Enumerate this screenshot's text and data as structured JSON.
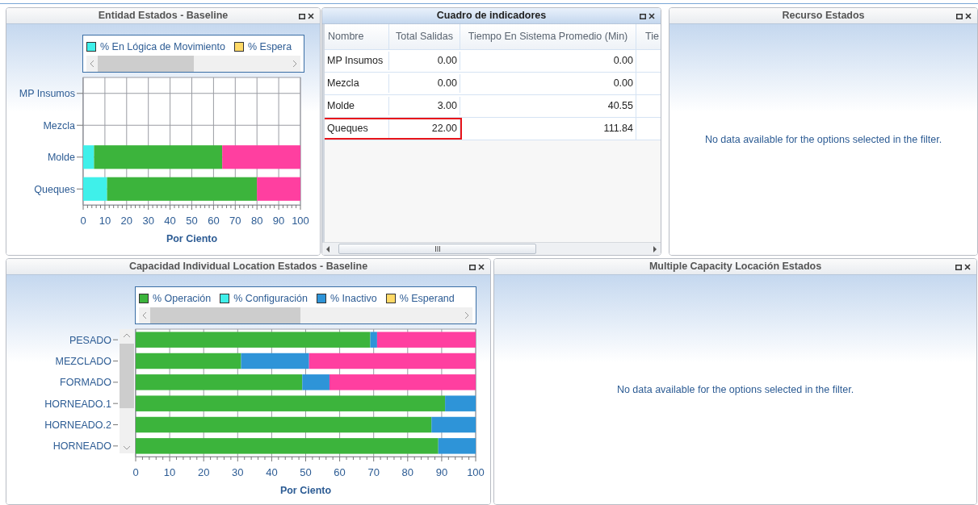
{
  "panels": [
    {
      "kind": "chart",
      "title": "Entidad Estados - Baseline",
      "chart_data": {
        "type": "bar",
        "orientation": "horizontal",
        "stacked": true,
        "grid": true,
        "xlabel": "Por Ciento",
        "xlim": [
          0,
          100
        ],
        "xticks": [
          0,
          10,
          20,
          30,
          40,
          50,
          60,
          70,
          80,
          90,
          100
        ],
        "categories": [
          "MP Insumos",
          "Mezcla",
          "Molde",
          "Queques"
        ],
        "series": [
          {
            "name": "% En Lógica de Movimiento",
            "color": "#3ff0ea",
            "values": [
              0,
              0,
              5,
              11
            ]
          },
          {
            "name": "% Espera",
            "color": "#ffd966",
            "values": [
              0,
              0,
              0,
              0
            ]
          },
          {
            "color": "#3cb43c",
            "values": [
              0,
              0,
              59,
              69
            ]
          },
          {
            "color": "#ff3fa0",
            "values": [
              0,
              0,
              36,
              20
            ]
          }
        ]
      }
    },
    {
      "kind": "table",
      "title": "Cuadro de indicadores",
      "columns": [
        "Nombre",
        "Total Salidas",
        "Tiempo En Sistema Promedio (Min)",
        "Tie"
      ],
      "rows": [
        {
          "cells": [
            "MP Insumos",
            "0.00",
            "0.00"
          ],
          "highlighted": false
        },
        {
          "cells": [
            "Mezcla",
            "0.00",
            "0.00"
          ],
          "highlighted": false
        },
        {
          "cells": [
            "Molde",
            "3.00",
            "40.55"
          ],
          "highlighted": false
        },
        {
          "cells": [
            "Queques",
            "22.00",
            "111.84"
          ],
          "highlighted": true
        }
      ]
    },
    {
      "kind": "empty",
      "title": "Recurso Estados",
      "message": "No data available for the options selected in the filter."
    },
    {
      "kind": "chart",
      "title": "Capacidad Individual Location Estados - Baseline",
      "chart_data": {
        "type": "bar",
        "orientation": "horizontal",
        "stacked": true,
        "grid": true,
        "xlabel": "Por Ciento",
        "xlim": [
          0,
          100
        ],
        "xticks": [
          0,
          10,
          20,
          30,
          40,
          50,
          60,
          70,
          80,
          90,
          100
        ],
        "categories": [
          "PESADO",
          "MEZCLADO",
          "FORMADO",
          "HORNEADO.1",
          "HORNEADO.2",
          "HORNEADO"
        ],
        "series": [
          {
            "name": "% Operación",
            "color": "#3cb43c",
            "values": [
              69,
              31,
              49,
              91,
              87,
              89
            ]
          },
          {
            "name": "% Configuración",
            "color": "#3ff0ea",
            "values": [
              0,
              0,
              0,
              0,
              0,
              0
            ]
          },
          {
            "name": "% Inactivo",
            "color": "#2e94d8",
            "values": [
              2,
              20,
              8,
              9,
              13,
              11
            ]
          },
          {
            "name": "% Esperand",
            "color": "#ffd966",
            "values": [
              0,
              0,
              0,
              0,
              0,
              0
            ]
          },
          {
            "color": "#ff3fa0",
            "values": [
              29,
              49,
              43,
              0,
              0,
              0
            ]
          }
        ]
      }
    },
    {
      "kind": "empty",
      "title": "Multiple Capacity Locación Estados",
      "message": "No data available for the options selected in the filter."
    }
  ]
}
